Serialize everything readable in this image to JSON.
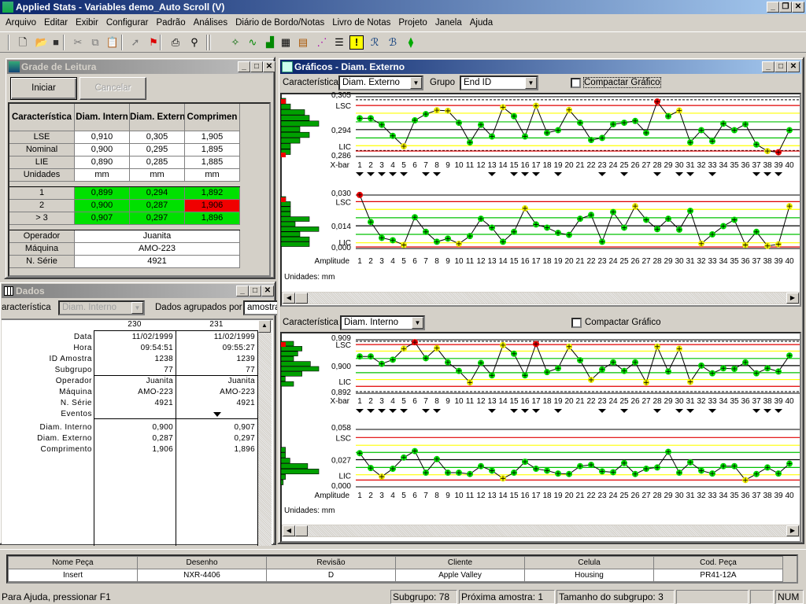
{
  "app": {
    "title": "Applied Stats - Variables demo_Auto Scroll (V)"
  },
  "menu": [
    "Arquivo",
    "Editar",
    "Exibir",
    "Configurar",
    "Padrão",
    "Análises",
    "Diário de Bordo/Notas",
    "Livro de Notas",
    "Projeto",
    "Janela",
    "Ajuda"
  ],
  "toolbar": {
    "icons": [
      "new-file",
      "open-folder",
      "save",
      "cut",
      "copy",
      "paste",
      "help-pointer",
      "flag",
      "print",
      "find",
      "wizard",
      "control-chart",
      "histogram",
      "table",
      "notes",
      "scatter",
      "list",
      "alert",
      "r-chart",
      "b-chart",
      "gauge"
    ]
  },
  "grade": {
    "title": "Grade de Leitura",
    "start_label": "Iniciar",
    "cancel_label": "Cancelar",
    "headers": [
      "Característica",
      "Diam. Intern",
      "Diam. Extern",
      "Comprimen"
    ],
    "spec_rows": [
      {
        "label": "LSE",
        "values": [
          "0,910",
          "0,305",
          "1,905"
        ]
      },
      {
        "label": "Nominal",
        "values": [
          "0,900",
          "0,295",
          "1,895"
        ]
      },
      {
        "label": "LIE",
        "values": [
          "0,890",
          "0,285",
          "1,885"
        ]
      },
      {
        "label": "Unidades",
        "values": [
          "mm",
          "mm",
          "mm"
        ]
      }
    ],
    "reading_rows": [
      {
        "label": "1",
        "values": [
          "0,899",
          "0,294",
          "1,892"
        ],
        "status": [
          "ok",
          "ok",
          "ok"
        ]
      },
      {
        "label": "2",
        "values": [
          "0,900",
          "0,287",
          "1,906"
        ],
        "status": [
          "ok",
          "ok",
          "out"
        ]
      },
      {
        "label": "> 3",
        "values": [
          "0,907",
          "0,297",
          "1,896"
        ],
        "status": [
          "ok",
          "ok",
          "ok"
        ]
      }
    ],
    "info_rows": [
      {
        "label": "Operador",
        "value": "Juanita"
      },
      {
        "label": "Máquina",
        "value": "AMO-223"
      },
      {
        "label": "N. Série",
        "value": "4921"
      }
    ]
  },
  "dados": {
    "title": "Dados",
    "char_label": "aracterística",
    "char_value": "Diam. Interno",
    "group_label": "Dados agrupados por",
    "group_value": "amostra",
    "columns": [
      "230",
      "231"
    ],
    "row_labels": [
      "Data",
      "Hora",
      "ID Amostra",
      "Subgrupo",
      "Operador",
      "Máquina",
      "N. Série",
      "Eventos",
      "Diam. Interno",
      "Diam. Externo",
      "Comprimento"
    ],
    "values": [
      [
        "11/02/1999",
        "09:54:51",
        "1238",
        "77",
        "Juanita",
        "AMO-223",
        "4921",
        "",
        "0,900",
        "0,287",
        "1,906"
      ],
      [
        "11/02/1999",
        "09:55:27",
        "1239",
        "77",
        "Juanita",
        "AMO-223",
        "4921",
        "event",
        "0,907",
        "0,297",
        "1,896"
      ]
    ]
  },
  "graficos": {
    "title": "Gráficos - Diam. Externo",
    "char_label": "Característica",
    "char_value": "Diam. Externo",
    "group_label": "Grupo",
    "group_value": "End ID",
    "compact_label": "Compactar Gráfico",
    "compact_checked": false,
    "section2": {
      "char_label": "Característica",
      "char_value": "Diam. Interno",
      "compact_label": "Compactar Gráfico",
      "compact_checked": false
    },
    "units1": "Unidades: mm",
    "units2": "Unidades: mm"
  },
  "chart_data": [
    {
      "type": "line",
      "label": "X-bar",
      "ylim": [
        0.286,
        0.305
      ],
      "tick_labels": [
        "0,305",
        "LSC",
        "0,294",
        "LIC",
        "0,286"
      ],
      "ucl": 0.3026,
      "lcl": 0.2873,
      "center": 0.2945,
      "warn": [
        0.3,
        0.2891
      ],
      "zone": [
        0.2971,
        0.2917
      ],
      "spec": [
        0.3045,
        0.2875
      ],
      "x": [
        1,
        2,
        3,
        4,
        5,
        6,
        7,
        8,
        9,
        10,
        11,
        12,
        13,
        14,
        15,
        16,
        17,
        18,
        19,
        20,
        21,
        22,
        23,
        24,
        25,
        26,
        27,
        28,
        29,
        30,
        31,
        32,
        33,
        34,
        35,
        36,
        37,
        38,
        39,
        40
      ],
      "values": [
        0.2983,
        0.2983,
        0.2961,
        0.2924,
        0.2889,
        0.2976,
        0.2997,
        0.301,
        0.3008,
        0.2968,
        0.2902,
        0.2961,
        0.2922,
        0.302,
        0.299,
        0.2922,
        0.3025,
        0.2934,
        0.2943,
        0.3011,
        0.2968,
        0.291,
        0.2917,
        0.2963,
        0.2968,
        0.2974,
        0.2934,
        0.3039,
        0.299,
        0.3009,
        0.2902,
        0.2943,
        0.2906,
        0.2965,
        0.2943,
        0.2963,
        0.2895,
        0.2873,
        0.2869,
        0.2943
      ],
      "events": [
        1,
        2,
        3,
        4,
        5,
        7,
        8,
        13,
        15,
        16,
        17,
        19,
        23,
        25,
        28,
        30,
        31,
        33,
        37,
        38,
        39
      ]
    },
    {
      "type": "line",
      "label": "Amplitude",
      "ylim": [
        0,
        0.03
      ],
      "tick_labels": [
        "0,030",
        "LSC",
        "0,014",
        "LIC",
        "0,000"
      ],
      "ucl": 0.027,
      "lcl": 0,
      "center": 0.0126,
      "warn": [
        0.0224,
        0.0025
      ],
      "zone": [
        0.0174,
        0.0075
      ],
      "x": [
        1,
        2,
        3,
        4,
        5,
        6,
        7,
        8,
        9,
        10,
        11,
        12,
        13,
        14,
        15,
        16,
        17,
        18,
        19,
        20,
        21,
        22,
        23,
        24,
        25,
        26,
        27,
        28,
        29,
        30,
        31,
        32,
        33,
        34,
        35,
        36,
        37,
        38,
        39,
        40
      ],
      "values": [
        0.031,
        0.0149,
        0.0054,
        0.004,
        0.0012,
        0.0177,
        0.009,
        0.0031,
        0.005,
        0.0019,
        0.0065,
        0.0168,
        0.0115,
        0.0031,
        0.009,
        0.023,
        0.0134,
        0.0115,
        0.0084,
        0.0072,
        0.0168,
        0.0191,
        0.0031,
        0.0208,
        0.0115,
        0.0243,
        0.0162,
        0.0106,
        0.0168,
        0.0103,
        0.0215,
        0.002,
        0.0075,
        0.0124,
        0.0162,
        0.0012,
        0.009,
        0.0006,
        0.0016,
        0.0243
      ]
    },
    {
      "type": "line",
      "label": "X-bar",
      "ylim": [
        0.892,
        0.909
      ],
      "tick_labels": [
        "0,909",
        "LSC",
        "0,900",
        "LIC",
        "0,892"
      ],
      "ucl": 0.9079,
      "lcl": 0.8938,
      "center": 0.9008,
      "warn": [
        0.9057,
        0.8961
      ],
      "zone": [
        0.9032,
        0.8984
      ],
      "spec": [
        0.909,
        0.892
      ],
      "x": [
        1,
        2,
        3,
        4,
        5,
        6,
        7,
        8,
        9,
        10,
        11,
        12,
        13,
        14,
        15,
        16,
        17,
        18,
        19,
        20,
        21,
        22,
        23,
        24,
        25,
        26,
        27,
        28,
        29,
        30,
        31,
        32,
        33,
        34,
        35,
        36,
        37,
        38,
        39,
        40
      ],
      "values": [
        0.9039,
        0.9039,
        0.9014,
        0.9028,
        0.9065,
        0.9087,
        0.9033,
        0.9067,
        0.9019,
        0.899,
        0.8951,
        0.9017,
        0.8975,
        0.9077,
        0.9048,
        0.8975,
        0.9081,
        0.8986,
        0.8999,
        0.9072,
        0.9026,
        0.896,
        0.8995,
        0.9019,
        0.899,
        0.9019,
        0.8951,
        0.9072,
        0.8988,
        0.9065,
        0.8953,
        0.9008,
        0.8982,
        0.8999,
        0.8997,
        0.9019,
        0.8982,
        0.8999,
        0.8988,
        0.9042
      ],
      "events": [
        1,
        2,
        3,
        4,
        5,
        7,
        8,
        13,
        15,
        16,
        17,
        19,
        23,
        25,
        28,
        30,
        31,
        33,
        37,
        38,
        39
      ]
    },
    {
      "type": "line",
      "label": "Amplitude",
      "ylim": [
        0,
        0.058
      ],
      "tick_labels": [
        "0,058",
        "LSC",
        "0,027",
        "LIC",
        "0,000"
      ],
      "ucl": 0.051,
      "lcl": 0.0056,
      "center": 0.0273,
      "warn": [
        0.0427,
        0.0112
      ],
      "zone": [
        0.0351,
        0.019
      ],
      "x": [
        1,
        2,
        3,
        4,
        5,
        6,
        7,
        8,
        9,
        10,
        11,
        12,
        13,
        14,
        15,
        16,
        17,
        18,
        19,
        20,
        21,
        22,
        23,
        24,
        25,
        26,
        27,
        28,
        29,
        30,
        31,
        32,
        33,
        34,
        35,
        36,
        37,
        38,
        39,
        40
      ],
      "values": [
        0.0343,
        0.0184,
        0.0092,
        0.0176,
        0.0296,
        0.0365,
        0.0134,
        0.0279,
        0.0134,
        0.0134,
        0.012,
        0.0204,
        0.0156,
        0.0073,
        0.0134,
        0.0251,
        0.0176,
        0.0156,
        0.0125,
        0.012,
        0.0204,
        0.0218,
        0.0148,
        0.0139,
        0.0237,
        0.012,
        0.0176,
        0.019,
        0.0357,
        0.0134,
        0.0245,
        0.0156,
        0.0125,
        0.0204,
        0.0204,
        0.0056,
        0.012,
        0.019,
        0.0125,
        0.0231
      ]
    }
  ],
  "part_info": {
    "headers": [
      "Nome Peça",
      "Desenho",
      "Revisão",
      "Cliente",
      "Celula",
      "Cod. Peça"
    ],
    "values": [
      "Insert",
      "NXR-4406",
      "D",
      "Apple Valley",
      "Housing",
      "PR41-12A"
    ]
  },
  "status": {
    "help": "Para Ajuda, pressionar F1",
    "subgroup": "Subgrupo: 78",
    "next_sample": "Próxima amostra: 1",
    "subgroup_size": "Tamanho do subgrupo: 3",
    "num": "NUM"
  },
  "colors": {
    "ok": "#00e000",
    "out": "#f00000",
    "warn": "#ffff00",
    "ucl": "#e00000",
    "zone": "#00c000",
    "title_active": "#0a246a"
  }
}
